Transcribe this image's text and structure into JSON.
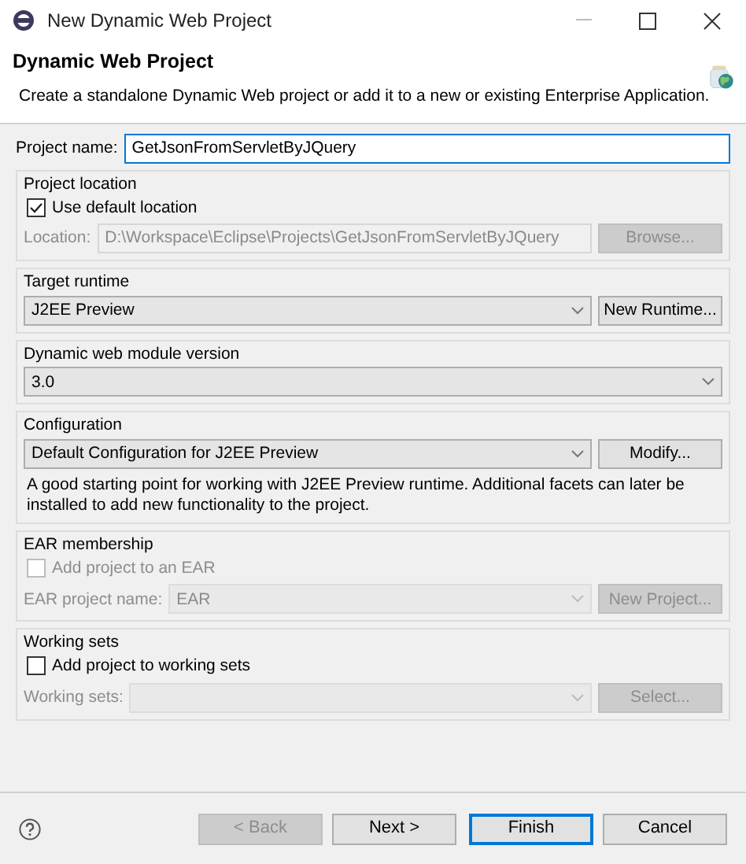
{
  "window": {
    "title": "New Dynamic Web Project"
  },
  "header": {
    "title": "Dynamic Web Project",
    "description": "Create a standalone Dynamic Web project or add it to a new or existing Enterprise Application."
  },
  "project_name": {
    "label": "Project name:",
    "value": "GetJsonFromServletByJQuery"
  },
  "groups": [
    {
      "title": "Project location",
      "rows": [
        {
          "kind": "checkbox",
          "label": "Use default location",
          "checked": true,
          "disabled": false
        },
        {
          "kind": "field",
          "label": "Location:",
          "value": "D:\\Workspace\\Eclipse\\Projects\\GetJsonFromServletByJQuery",
          "dropdown": false,
          "disabled": true,
          "button": {
            "label": "Browse...",
            "disabled": true
          }
        }
      ]
    },
    {
      "title": "Target runtime",
      "rows": [
        {
          "kind": "field",
          "value": "J2EE Preview",
          "dropdown": true,
          "disabled": false,
          "button": {
            "label": "New Runtime...",
            "disabled": false
          }
        }
      ]
    },
    {
      "title": "Dynamic web module version",
      "rows": [
        {
          "kind": "field",
          "value": "3.0",
          "dropdown": true,
          "disabled": false
        }
      ]
    },
    {
      "title": "Configuration",
      "rows": [
        {
          "kind": "field",
          "value": "Default Configuration for J2EE Preview",
          "dropdown": true,
          "disabled": false,
          "button": {
            "label": "Modify...",
            "disabled": false
          }
        },
        {
          "kind": "note",
          "text": "A good starting point for working with J2EE Preview runtime. Additional facets can later be installed to add new functionality to the project."
        }
      ]
    },
    {
      "title": "EAR membership",
      "rows": [
        {
          "kind": "checkbox",
          "label": "Add project to an EAR",
          "checked": false,
          "disabled": true
        },
        {
          "kind": "field",
          "label": "EAR project name:",
          "value": "EAR",
          "dropdown": true,
          "disabled": true,
          "button": {
            "label": "New Project...",
            "disabled": true
          }
        }
      ]
    },
    {
      "title": "Working sets",
      "rows": [
        {
          "kind": "checkbox",
          "label": "Add project to working sets",
          "checked": false,
          "disabled": false
        },
        {
          "kind": "field",
          "label": "Working sets:",
          "dropdown": true,
          "disabled": true,
          "button": {
            "label": "Select...",
            "disabled": true
          }
        }
      ]
    }
  ],
  "buttons": [
    {
      "label": "< Back",
      "disabled": true,
      "default": false
    },
    {
      "label": "Next >",
      "disabled": false,
      "default": false
    },
    {
      "label": "Finish",
      "disabled": false,
      "default": true
    },
    {
      "label": "Cancel",
      "disabled": false,
      "default": false
    }
  ]
}
